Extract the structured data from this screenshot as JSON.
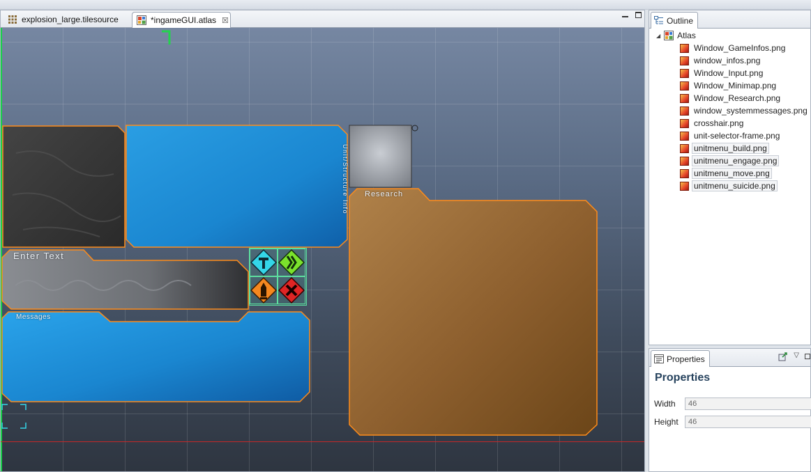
{
  "editor": {
    "tabs": [
      {
        "label": "explosion_large.tilesource",
        "active": false
      },
      {
        "label": "*ingameGUI.atlas",
        "active": true,
        "close": "☒"
      }
    ]
  },
  "canvas": {
    "images": {
      "window_infos": {
        "label": "Unit/Structure Info"
      },
      "window_input": {
        "label": "Enter Text"
      },
      "window_systemmessages": {
        "label": "Messages"
      },
      "window_research": {
        "label": "Research"
      }
    },
    "colors": {
      "blue": "#1f8fd8",
      "brown": "#9a6a35",
      "dark": "#3a3a3a",
      "selection": "#ff8c1a"
    }
  },
  "outline": {
    "tab_label": "Outline",
    "root_label": "Atlas",
    "items": [
      {
        "label": "Window_GameInfos.png",
        "selected": false
      },
      {
        "label": "window_infos.png",
        "selected": false
      },
      {
        "label": "Window_Input.png",
        "selected": false
      },
      {
        "label": "Window_Minimap.png",
        "selected": false
      },
      {
        "label": "Window_Research.png",
        "selected": false
      },
      {
        "label": "window_systemmessages.png",
        "selected": false
      },
      {
        "label": "crosshair.png",
        "selected": false
      },
      {
        "label": "unit-selector-frame.png",
        "selected": false
      },
      {
        "label": "unitmenu_build.png",
        "selected": true
      },
      {
        "label": "unitmenu_engage.png",
        "selected": true
      },
      {
        "label": "unitmenu_move.png",
        "selected": true
      },
      {
        "label": "unitmenu_suicide.png",
        "selected": true
      }
    ]
  },
  "properties": {
    "tab_label": "Properties",
    "heading": "Properties",
    "fields": {
      "width": {
        "label": "Width",
        "value": "46"
      },
      "height": {
        "label": "Height",
        "value": "46"
      }
    }
  }
}
